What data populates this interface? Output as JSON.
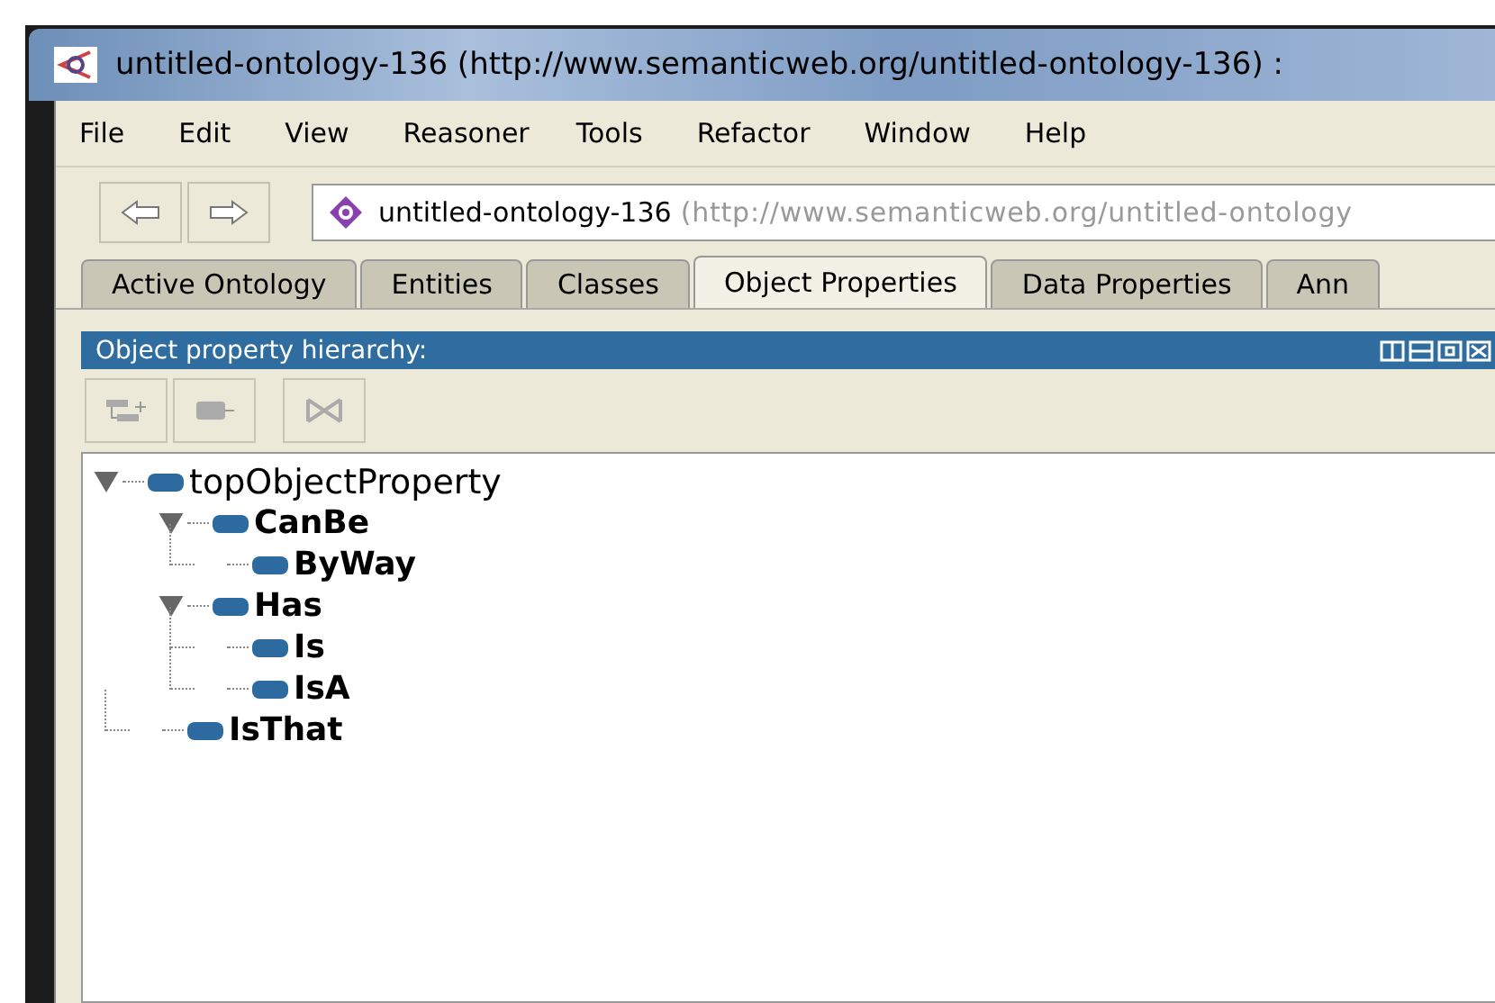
{
  "window": {
    "title": "untitled-ontology-136 (http://www.semanticweb.org/untitled-ontology-136)  :"
  },
  "menu": [
    "File",
    "Edit",
    "View",
    "Reasoner",
    "Tools",
    "Refactor",
    "Window",
    "Help"
  ],
  "address": {
    "name": "untitled-ontology-136",
    "iri": "(http://www.semanticweb.org/untitled-ontology"
  },
  "tabs": [
    {
      "label": "Active Ontology",
      "selected": false
    },
    {
      "label": "Entities",
      "selected": false
    },
    {
      "label": "Classes",
      "selected": false
    },
    {
      "label": "Object Properties",
      "selected": true
    },
    {
      "label": "Data Properties",
      "selected": false
    },
    {
      "label": "Ann",
      "selected": false
    }
  ],
  "panel": {
    "title": "Object property hierarchy:"
  },
  "tree": [
    {
      "label": "topObjectProperty",
      "bold": false,
      "expanded": true,
      "children": [
        {
          "label": "CanBe",
          "bold": true,
          "expanded": true,
          "children": [
            {
              "label": "ByWay",
              "bold": true
            }
          ]
        },
        {
          "label": "Has",
          "bold": true,
          "expanded": true,
          "children": [
            {
              "label": "Is",
              "bold": true
            },
            {
              "label": "IsA",
              "bold": true
            }
          ]
        },
        {
          "label": "IsThat",
          "bold": true
        }
      ]
    }
  ]
}
